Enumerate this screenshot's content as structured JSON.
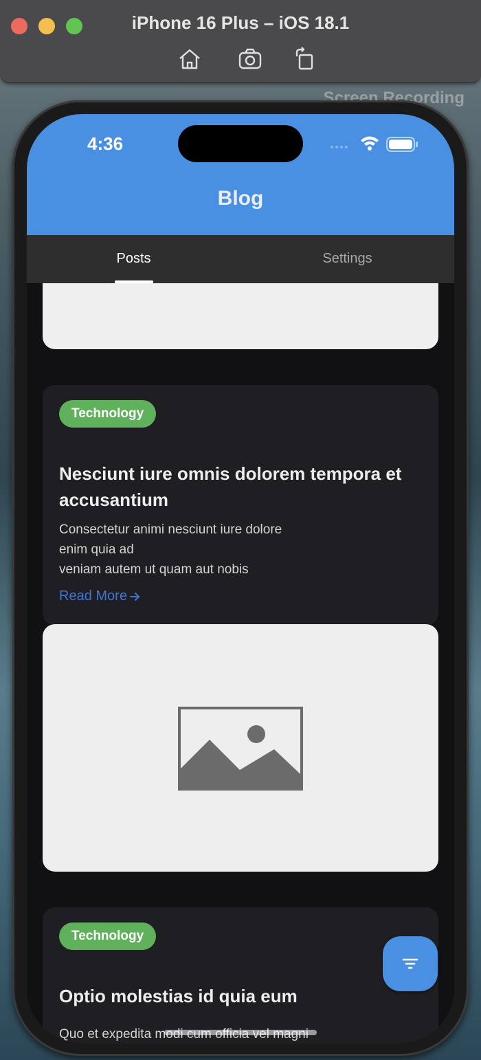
{
  "simulator": {
    "title": "iPhone 16 Plus – iOS 18.1",
    "tools": [
      "home-icon",
      "screenshot-icon",
      "rotate-icon"
    ],
    "recording_label": "Screen Recording"
  },
  "status_bar": {
    "time": "4:36",
    "icons": [
      "cellular-dots-icon",
      "wifi-icon",
      "battery-icon"
    ]
  },
  "app": {
    "title": "Blog",
    "accent_color": "#4a90e2"
  },
  "tabs": [
    {
      "label": "Posts",
      "selected": true
    },
    {
      "label": "Settings",
      "selected": false
    }
  ],
  "posts": [
    {
      "category": "Technology",
      "category_color": "#5fb25b",
      "title": "Nesciunt iure omnis dolorem tempora et accusantium",
      "excerpt_lines": [
        "Consectetur animi nesciunt iure dolore",
        "enim quia ad",
        "veniam autem ut quam aut nobis"
      ],
      "read_more": "Read More",
      "image": "image-placeholder-icon"
    },
    {
      "category": "Technology",
      "category_color": "#5fb25b",
      "title": "Optio molestias id quia eum",
      "excerpt_lines": [
        "Quo et expedita modi cum officia vel magni"
      ]
    }
  ],
  "fab": {
    "icon": "filter-icon"
  }
}
